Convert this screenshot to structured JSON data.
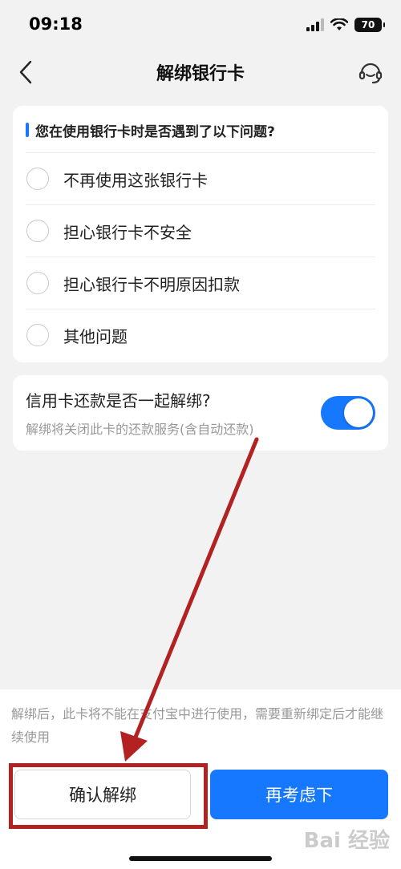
{
  "status_bar": {
    "time": "09:18",
    "battery": "70"
  },
  "nav": {
    "title": "解绑银行卡",
    "back_icon": "chevron-left-icon",
    "service_icon": "customer-service-icon"
  },
  "question": {
    "title": "您在使用银行卡时是否遇到了以下问题?",
    "options": [
      "不再使用这张银行卡",
      "担心银行卡不安全",
      "担心银行卡不明原因扣款",
      "其他问题"
    ]
  },
  "credit": {
    "title": "信用卡还款是否一起解绑?",
    "subtitle": "解绑将关闭此卡的还款服务(含自动还款)",
    "toggle_on": true
  },
  "bottom": {
    "notice": "解绑后，此卡将不能在支付宝中进行使用，需要重新绑定后才能继续使用",
    "confirm_label": "确认解绑",
    "reconsider_label": "再考虑下"
  },
  "watermark": "Bai 经验",
  "colors": {
    "accent": "#1677ff",
    "annotation": "#b22222",
    "background": "#f2f2f2"
  }
}
